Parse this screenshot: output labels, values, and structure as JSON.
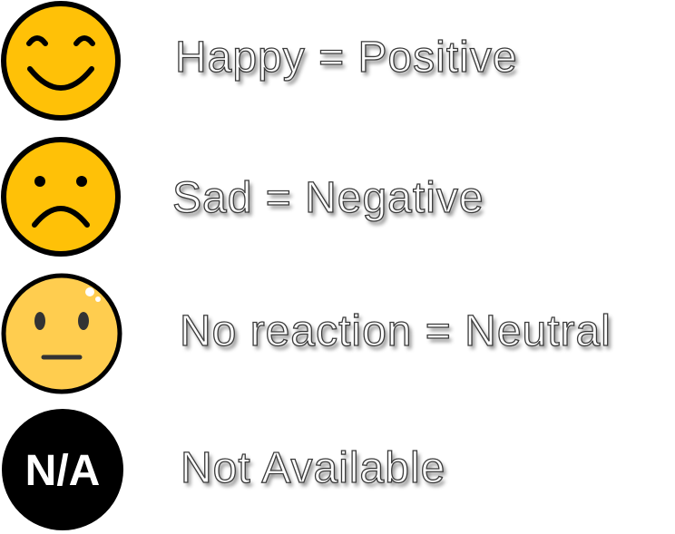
{
  "legend": {
    "items": [
      {
        "icon": "happy-face-icon",
        "label": "Happy = Positive",
        "color": "#FFC107"
      },
      {
        "icon": "sad-face-icon",
        "label": "Sad = Negative",
        "color": "#FFC107"
      },
      {
        "icon": "neutral-face-icon",
        "label": "No reaction = Neutral",
        "color": "#FFCD4F"
      },
      {
        "icon": "not-available-icon",
        "label": "Not Available",
        "badge_text": "N/A",
        "color": "#000000"
      }
    ]
  }
}
